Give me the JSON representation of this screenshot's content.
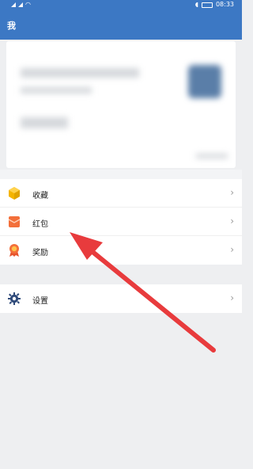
{
  "status_bar": {
    "time": "08:33",
    "battery_icon": "battery-icon",
    "signal_icon": "signal-icon",
    "wifi_icon": "wifi-icon",
    "headset_icon": "headset-icon"
  },
  "header": {
    "title": "我",
    "background_color": "#3c78c4"
  },
  "profile_card": {
    "avatar_icon": "avatar-blurred"
  },
  "menu": {
    "group1": [
      {
        "label": "收藏",
        "icon": "cube-icon",
        "icon_color": "#f4b400"
      },
      {
        "label": "红包",
        "icon": "envelope-icon",
        "icon_color": "#f36f3a"
      },
      {
        "label": "奖励",
        "icon": "medal-icon",
        "icon_color": "#e7552d"
      }
    ],
    "group2": [
      {
        "label": "设置",
        "icon": "gear-icon",
        "icon_color": "#2f4a7a"
      }
    ],
    "chevron_icon": "chevron-right-icon"
  },
  "annotation": {
    "arrow_color": "#e83b3d",
    "arrow_icon": "red-arrow-icon"
  }
}
